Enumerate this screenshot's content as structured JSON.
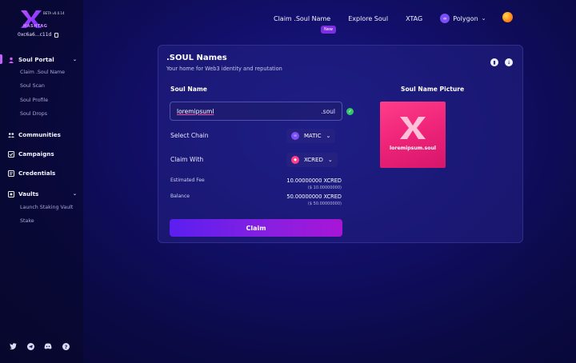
{
  "brand": {
    "name": "HASHTAG",
    "beta": "BETA v0.0.14",
    "wallet": "0xc6a6...c11d"
  },
  "sidebar": {
    "sections": [
      {
        "label": "Soul Portal",
        "icon": "user-icon",
        "expandable": true
      },
      {
        "label": "Communities",
        "icon": "communities-icon",
        "expandable": false
      },
      {
        "label": "Campaigns",
        "icon": "campaigns-icon",
        "expandable": false
      },
      {
        "label": "Credentials",
        "icon": "credentials-icon",
        "expandable": false
      },
      {
        "label": "Vaults",
        "icon": "vault-icon",
        "expandable": true
      }
    ],
    "soul_portal_items": [
      "Claim .Soul Name",
      "Soul Scan",
      "Soul Profile",
      "Soul Drops"
    ],
    "vault_items": [
      "Launch Staking Vault",
      "Stake"
    ]
  },
  "topnav": {
    "claim": "Claim .Soul Name",
    "new_badge": "New",
    "explore": "Explore Soul",
    "xtag": "XTAG",
    "network": "Polygon"
  },
  "card": {
    "title": ".SOUL Names",
    "subtitle": "Your home for Web3 identity and reputation",
    "soul_name_label": "Soul Name",
    "soul_name_value": "loremipsuml",
    "suffix": ".soul",
    "picture_label": "Soul Name Picture",
    "select_chain_label": "Select Chain",
    "chain_value": "MATIC",
    "claim_with_label": "Claim With",
    "token_value": "XCRED",
    "estimated_fee_label": "Estimated Fee",
    "estimated_fee_value": "10.00000000 XCRED",
    "estimated_fee_usd": "($ 10.00000000)",
    "balance_label": "Balance",
    "balance_value": "50.00000000 XCRED",
    "balance_usd": "($ 50.00000000)",
    "claim_button": "Claim",
    "picture_name": "loremipsum.soul"
  },
  "colors": {
    "accent": "#8a1fe0",
    "pink": "#f0267a",
    "success": "#35c46a"
  }
}
